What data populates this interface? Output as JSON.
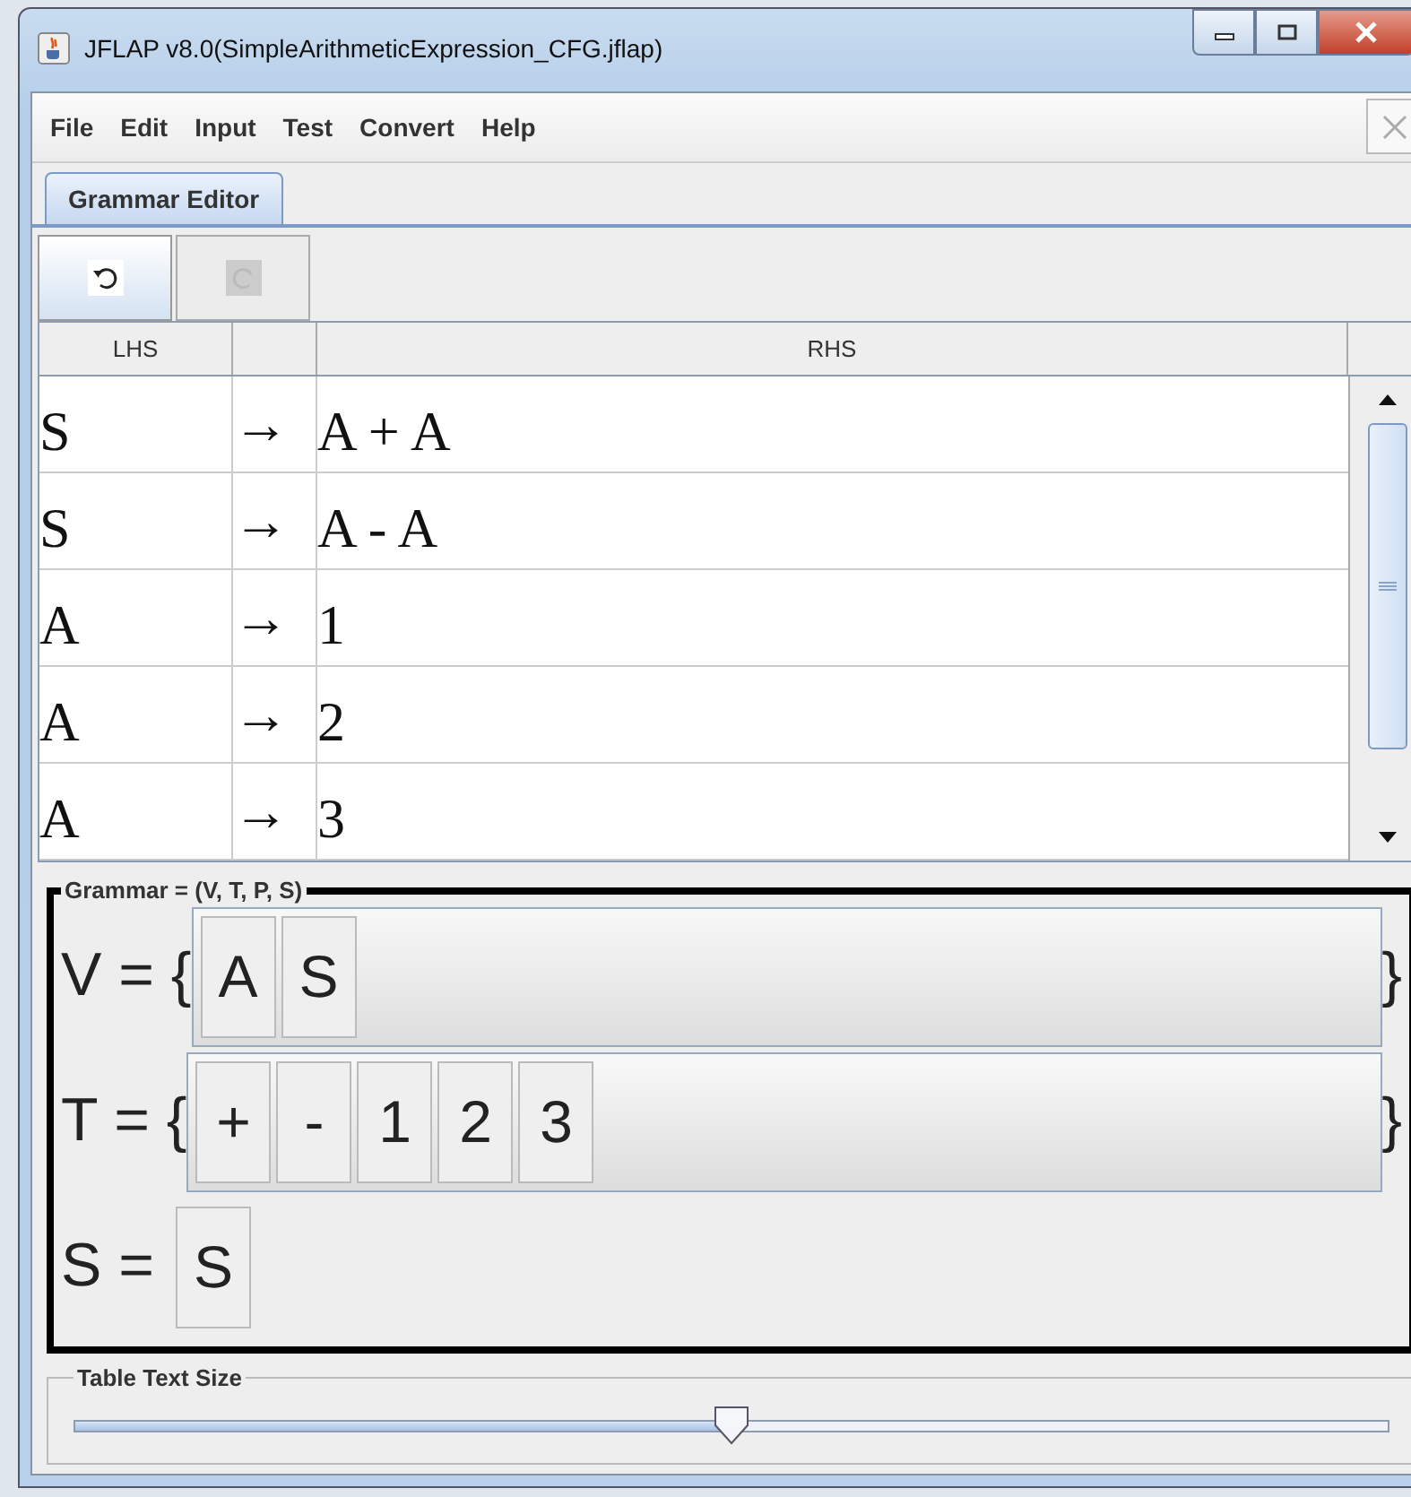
{
  "window": {
    "title": "JFLAP v8.0(SimpleArithmeticExpression_CFG.jflap)"
  },
  "menu": [
    "File",
    "Edit",
    "Input",
    "Test",
    "Convert",
    "Help"
  ],
  "tabs": [
    {
      "label": "Grammar Editor",
      "selected": true
    }
  ],
  "toolbar": [
    {
      "kind": "undo",
      "disabled": false
    },
    {
      "kind": "redo",
      "disabled": true
    }
  ],
  "table": {
    "columns": [
      "LHS",
      "",
      "RHS"
    ],
    "rows": [
      {
        "lhs": "S",
        "arrow": "→",
        "rhs": "A + A"
      },
      {
        "lhs": "S",
        "arrow": "→",
        "rhs": "A - A"
      },
      {
        "lhs": "A",
        "arrow": "→",
        "rhs": "1"
      },
      {
        "lhs": "A",
        "arrow": "→",
        "rhs": "2"
      },
      {
        "lhs": "A",
        "arrow": "→",
        "rhs": "3"
      }
    ]
  },
  "grammar": {
    "title": "Grammar = (V, T, P, S)",
    "sets": [
      {
        "label": "V = {",
        "items": [
          "A",
          "S"
        ],
        "close": "}"
      },
      {
        "label": "T = {",
        "items": [
          "+",
          "-",
          "1",
          "2",
          "3"
        ],
        "close": "}"
      }
    ],
    "start": {
      "label": "S =",
      "value": "S"
    }
  },
  "text_size": {
    "title": "Table Text Size",
    "level": 0.5
  }
}
